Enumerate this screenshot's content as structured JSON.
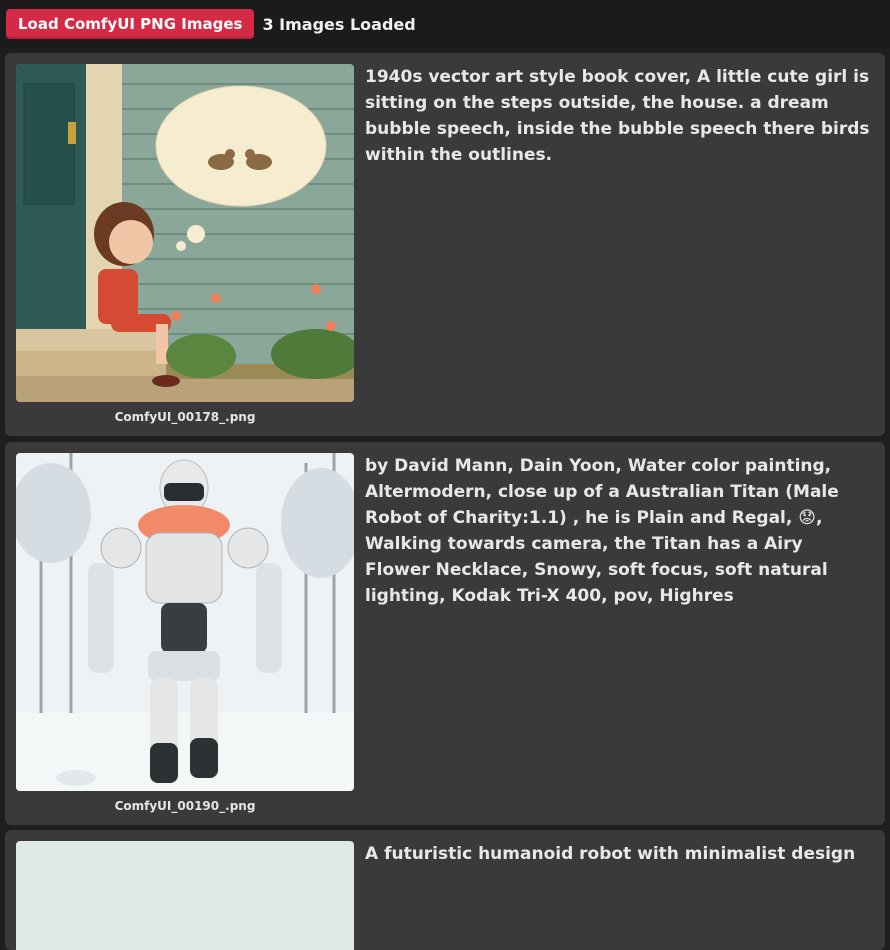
{
  "toolbar": {
    "load_label": "Load ComfyUI PNG Images",
    "status": "3 Images Loaded"
  },
  "images": [
    {
      "filename": "ComfyUI_00178_.png",
      "prompt": "1940s vector art style book cover, A little cute girl is sitting on the steps outside, the house. a dream bubble speech, inside the bubble speech there birds within the outlines."
    },
    {
      "filename": "ComfyUI_00190_.png",
      "prompt": "by David Mann, Dain Yoon, Water color painting, Altermodern, close up of a Australian Titan (Male Robot of Charity:1.1) , he is Plain and Regal, 😟, Walking towards camera, the Titan has a Airy Flower Necklace, Snowy, soft focus, soft natural lighting, Kodak Tri-X 400, pov, Highres"
    },
    {
      "filename": "",
      "prompt": "A futuristic humanoid robot with minimalist design"
    }
  ],
  "colors": {
    "accent": "#d42a45",
    "card": "#3a3a3a",
    "background": "#1e1e1e"
  }
}
